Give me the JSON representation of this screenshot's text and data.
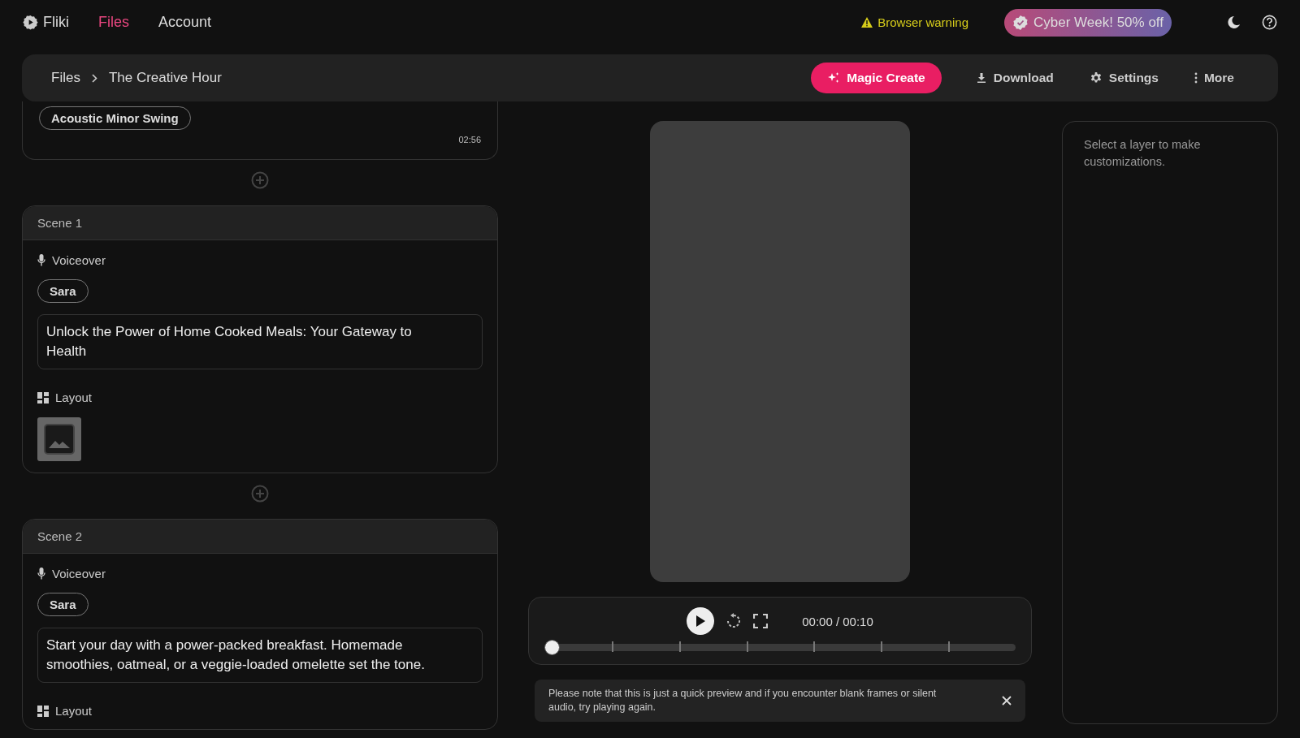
{
  "nav": {
    "brand": "Fliki",
    "items": [
      {
        "label": "Files",
        "selected": true
      },
      {
        "label": "Account",
        "selected": false
      }
    ],
    "warning": "Browser warning",
    "promo": "Cyber Week! 50% off"
  },
  "breadcrumb": [
    "Files",
    "The Creative Hour"
  ],
  "actions": [
    {
      "kind": "magic",
      "label": "Magic Create"
    },
    {
      "kind": "download",
      "label": "Download"
    },
    {
      "kind": "settings",
      "label": "Settings"
    },
    {
      "kind": "more",
      "label": "More"
    }
  ],
  "music": {
    "track": "Acoustic Minor Swing",
    "duration": "02:56"
  },
  "scenes": [
    {
      "title": "Scene 1",
      "voiceover_label": "Voiceover",
      "voice": "Sara",
      "script": "Unlock the Power of Home Cooked Meals: Your Gateway to Health",
      "layout_label": "Layout",
      "layouts": [
        {
          "kind": "image"
        }
      ]
    },
    {
      "title": "Scene 2",
      "voiceover_label": "Voiceover",
      "voice": "Sara",
      "script": "Start your day with a power-packed breakfast. Homemade smoothies, oatmeal, or a veggie-loaded omelette set the tone.",
      "layout_label": "Layout"
    }
  ],
  "player": {
    "time": "00:00 / 00:10",
    "level": 0
  },
  "notice": "Please note that this is just a quick preview and if you encounter blank frames or silent audio, try playing again.",
  "inspector": {
    "hint": "Select a layer to make customizations."
  }
}
